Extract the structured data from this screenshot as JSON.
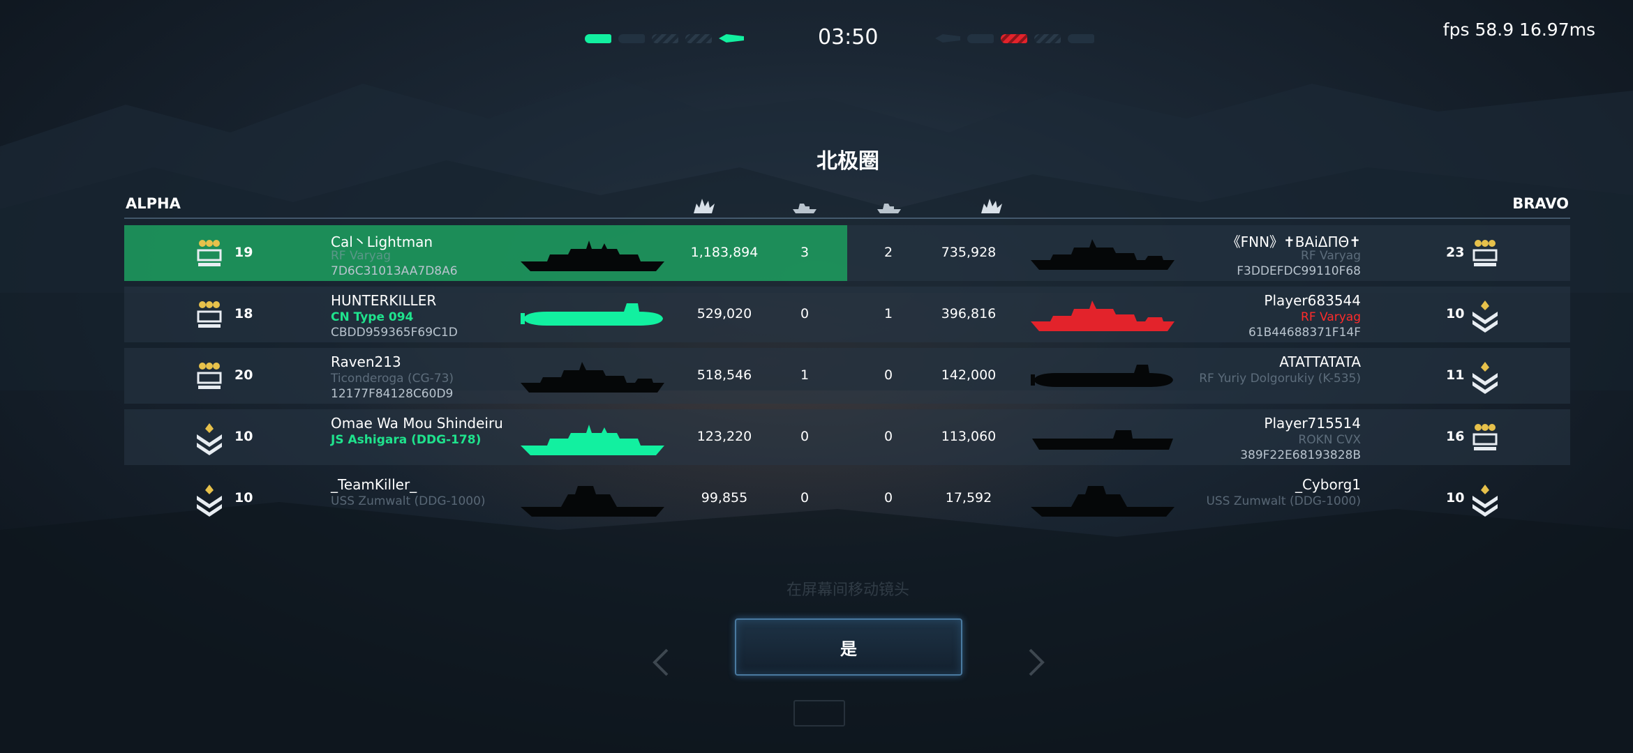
{
  "top": {
    "timer": "03:50",
    "fps": "fps 58.9  16.97ms"
  },
  "colors": {
    "ally": "#12f0a0",
    "enemy": "#e3232b",
    "highlight": "#1fa865",
    "text": "#ffffff"
  },
  "map": {
    "title": "北极圈"
  },
  "teams": {
    "alpha": "ALPHA",
    "bravo": "BRAVO"
  },
  "header_icons": [
    "damage-icon",
    "ship-kills-icon",
    "ship-kills-icon",
    "damage-icon"
  ],
  "alpha": [
    {
      "level": "19",
      "name": "Cal丶Lightman",
      "ship": "RF Varyag",
      "id": "7D6C31013AA7D8A6",
      "damage": "1,183,894",
      "kills": "3",
      "ship_status": "highlighted",
      "rank_icon": "rank-three-stars-icon",
      "ship_icon": "destroyer-silhouette-icon"
    },
    {
      "level": "18",
      "name": "HUNTERKILLER",
      "ship": "CN Type 094",
      "id": "CBDD959365F69C1D",
      "damage": "529,020",
      "kills": "0",
      "ship_status": "alive",
      "rank_icon": "rank-two-stars-icon",
      "ship_icon": "submarine-silhouette-icon"
    },
    {
      "level": "20",
      "name": "Raven213",
      "ship": "Ticonderoga (CG-73)",
      "id": "12177F84128C60D9",
      "damage": "518,546",
      "kills": "1",
      "ship_status": "destroyed",
      "rank_icon": "rank-four-stars-icon",
      "ship_icon": "cruiser-silhouette-icon"
    },
    {
      "level": "10",
      "name": "Omae Wa Mou Shindeiru",
      "ship": "JS Ashigara (DDG-178)",
      "id": "",
      "damage": "123,220",
      "kills": "0",
      "ship_status": "alive",
      "rank_icon": "rank-chevrons-icon",
      "ship_icon": "destroyer-silhouette-icon"
    },
    {
      "level": "10",
      "name": "_TeamKiller_",
      "ship": "USS Zumwalt (DDG-1000)",
      "id": "",
      "damage": "99,855",
      "kills": "0",
      "ship_status": "destroyed",
      "rank_icon": "rank-chevrons-icon",
      "ship_icon": "stealth-destroyer-silhouette-icon"
    }
  ],
  "bravo": [
    {
      "level": "23",
      "name": "《FNN》✝ВАіΔΠΘ✝",
      "ship": "RF Varyag",
      "id": "F3DDEFDC99110F68",
      "damage": "735,928",
      "kills": "2",
      "ship_status": "destroyed",
      "rank_icon": "rank-three-stars-icon",
      "ship_icon": "cruiser-silhouette-icon"
    },
    {
      "level": "10",
      "name": "Player683544",
      "ship": "RF Varyag",
      "id": "61B44688371F14F",
      "damage": "396,816",
      "kills": "1",
      "ship_status": "alive",
      "rank_icon": "rank-chevrons-icon",
      "ship_icon": "cruiser-silhouette-icon"
    },
    {
      "level": "11",
      "name": "ATATTATATA",
      "ship": "RF Yuriy Dolgorukiy (K-535)",
      "id": "",
      "damage": "142,000",
      "kills": "0",
      "ship_status": "destroyed",
      "rank_icon": "rank-chevrons-icon",
      "ship_icon": "submarine-silhouette-icon"
    },
    {
      "level": "16",
      "name": "Player715514",
      "ship": "ROKN CVX",
      "id": "389F22E68193828B",
      "damage": "113,060",
      "kills": "0",
      "ship_status": "destroyed",
      "rank_icon": "rank-four-stars-icon",
      "ship_icon": "carrier-silhouette-icon"
    },
    {
      "level": "10",
      "name": "_Cyborg1",
      "ship": "USS Zumwalt (DDG-1000)",
      "id": "",
      "damage": "17,592",
      "kills": "0",
      "ship_status": "destroyed",
      "rank_icon": "rank-chevrons-icon",
      "ship_icon": "stealth-destroyer-silhouette-icon"
    }
  ],
  "hint": "在屏幕间移动镜头",
  "confirm": {
    "label": "是"
  }
}
